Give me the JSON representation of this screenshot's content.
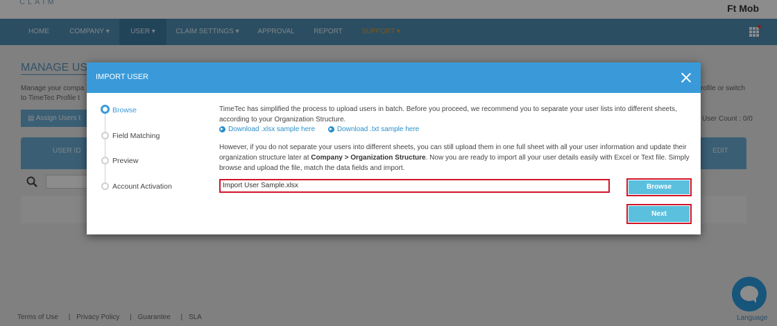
{
  "app": {
    "logo_text": "CLAIM",
    "user_name": "Ft Mob"
  },
  "nav": {
    "items": [
      {
        "label": "HOME"
      },
      {
        "label": "COMPANY ▾"
      },
      {
        "label": "USER ▾"
      },
      {
        "label": "CLAIM SETTINGS ▾"
      },
      {
        "label": "APPROVAL"
      },
      {
        "label": "REPORT"
      },
      {
        "label": "SUPPORT ▾"
      }
    ],
    "active_index": 2
  },
  "page": {
    "title": "MANAGE USE",
    "desc_line1": "Manage your compa",
    "desc_line2": "to TimeTec Profile t",
    "desc_right": "rofile or switch",
    "assign_button": "Assign Users t",
    "user_count": "User Count : 0/0",
    "table_headers": {
      "user_id": "USER ID",
      "edit": "EDIT"
    }
  },
  "modal": {
    "title": "IMPORT USER",
    "steps": [
      {
        "label": "Browse",
        "active": true
      },
      {
        "label": "Field Matching",
        "active": false
      },
      {
        "label": "Preview",
        "active": false
      },
      {
        "label": "Account Activation",
        "active": false
      }
    ],
    "intro_text": "TimeTec has simplified the process to upload users in batch. Before you proceed, we recommend you to separate your user lists into different sheets, according to your Organization Structure.",
    "download_xlsx": "Download .xlsx sample here",
    "download_txt": "Download .txt sample here",
    "para2_before": "However, if you do not separate your users into different sheets, you can still upload them in one full sheet with all your user information and update their organization structure later at ",
    "para2_bold": "Company > Organization Structure",
    "para2_after": ". Now you are ready to import all your user details easily with Excel or Text file. Simply browse and upload the file, match the data fields and import.",
    "file_value": "Import User Sample.xlsx",
    "browse_label": "Browse",
    "next_label": "Next"
  },
  "footer": {
    "links": [
      "Terms of Use",
      "Privacy Policy",
      "Guarantee",
      "SLA"
    ],
    "language": "Language"
  },
  "colors": {
    "navbar": "#4f8fb5",
    "modal_header": "#3a9ad9",
    "button": "#5bc0de",
    "highlight_border": "#d0142a",
    "link": "#2a8fc9"
  }
}
